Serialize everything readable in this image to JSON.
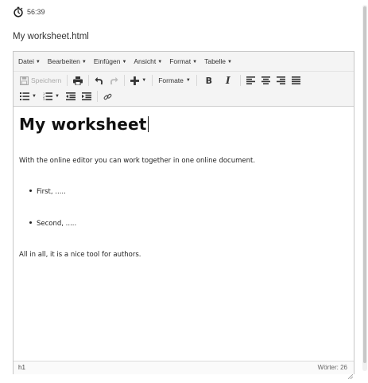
{
  "timer": {
    "icon": "stopwatch-icon",
    "value": "56:39"
  },
  "document": {
    "filename": "My worksheet.html"
  },
  "menubar": {
    "items": [
      {
        "label": "Datei"
      },
      {
        "label": "Bearbeiten"
      },
      {
        "label": "Einfügen"
      },
      {
        "label": "Ansicht"
      },
      {
        "label": "Format"
      },
      {
        "label": "Tabelle"
      }
    ]
  },
  "toolbar": {
    "save_label": "Speichern",
    "formats_label": "Formate",
    "bold_glyph": "B",
    "italic_glyph": "I"
  },
  "content": {
    "heading": "My worksheet",
    "paragraph1": "With the online editor you can work together in one online document.",
    "list_items": [
      "First, .....",
      "Second, ....."
    ],
    "paragraph2": "All in all, it is a nice tool for authors."
  },
  "statusbar": {
    "path": "h1",
    "word_count": "Wörter: 26"
  },
  "colors": {
    "toolbar_bg": "#f4f4f4",
    "border": "#c6c6c6",
    "text": "#333333"
  }
}
